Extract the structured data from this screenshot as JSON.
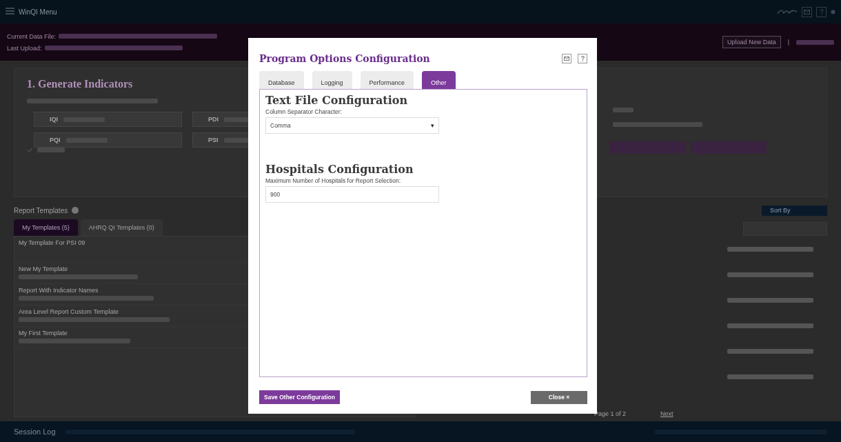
{
  "top_bar": {
    "menu_label": "WinQI Menu"
  },
  "data_bar": {
    "current_label": "Current Data File:",
    "last_label": "Last Upload:",
    "upload_button": "Upload New Data",
    "separator": "|"
  },
  "generate": {
    "title": "1. Generate Indicators",
    "modules": [
      {
        "code": "IQI"
      },
      {
        "code": "PDI"
      },
      {
        "code": "PQI"
      },
      {
        "code": "PSI"
      }
    ]
  },
  "templates": {
    "title": "Report Templates",
    "sort_label": "Sort By",
    "tabs": [
      {
        "label": "My Templates (5)",
        "selected": true
      },
      {
        "label": "AHRQ QI Templates (0)",
        "selected": false
      }
    ],
    "rows": [
      {
        "name": "My Template For PSI 09"
      },
      {
        "name": "New My Template"
      },
      {
        "name": "Report With Indicator Names"
      },
      {
        "name": "Area Level Report Custom Template"
      },
      {
        "name": "My First Template"
      }
    ],
    "pager": {
      "page": "Page 1 of 2",
      "next": "Next"
    }
  },
  "session_log": {
    "title": "Session Log"
  },
  "dialog": {
    "title": "Program Options Configuration",
    "tabs": [
      {
        "label": "Database",
        "selected": false
      },
      {
        "label": "Logging",
        "selected": false
      },
      {
        "label": "Performance",
        "selected": false
      },
      {
        "label": "Other",
        "selected": true
      }
    ],
    "sections": [
      {
        "heading": "Text File Configuration",
        "label": "Column Separator Character:",
        "kind": "select",
        "value": "Comma",
        "caret": "▾"
      },
      {
        "heading": "Hospitals Configuration",
        "label": "Maximum Number of Hospitals for Report Selection:",
        "kind": "input",
        "value": "900"
      }
    ],
    "save_button": "Save Other Configuration",
    "close_button": "Close",
    "close_mark": "×"
  }
}
